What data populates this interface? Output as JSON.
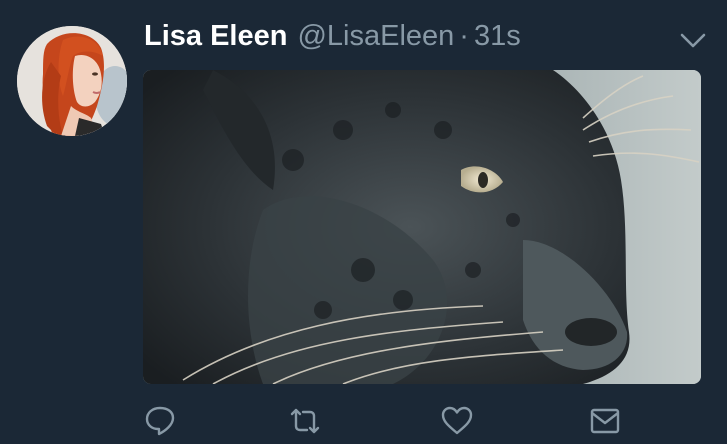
{
  "tweet": {
    "display_name": "Lisa Eleen",
    "handle": "@LisaEleen",
    "separator": "·",
    "time": "31s"
  },
  "icons": {
    "menu": "chevron-down-icon",
    "reply": "reply-icon",
    "retweet": "retweet-icon",
    "like": "heart-icon",
    "message": "envelope-icon"
  },
  "colors": {
    "background": "#1b2836",
    "name": "#ffffff",
    "secondary": "#8899a6"
  }
}
